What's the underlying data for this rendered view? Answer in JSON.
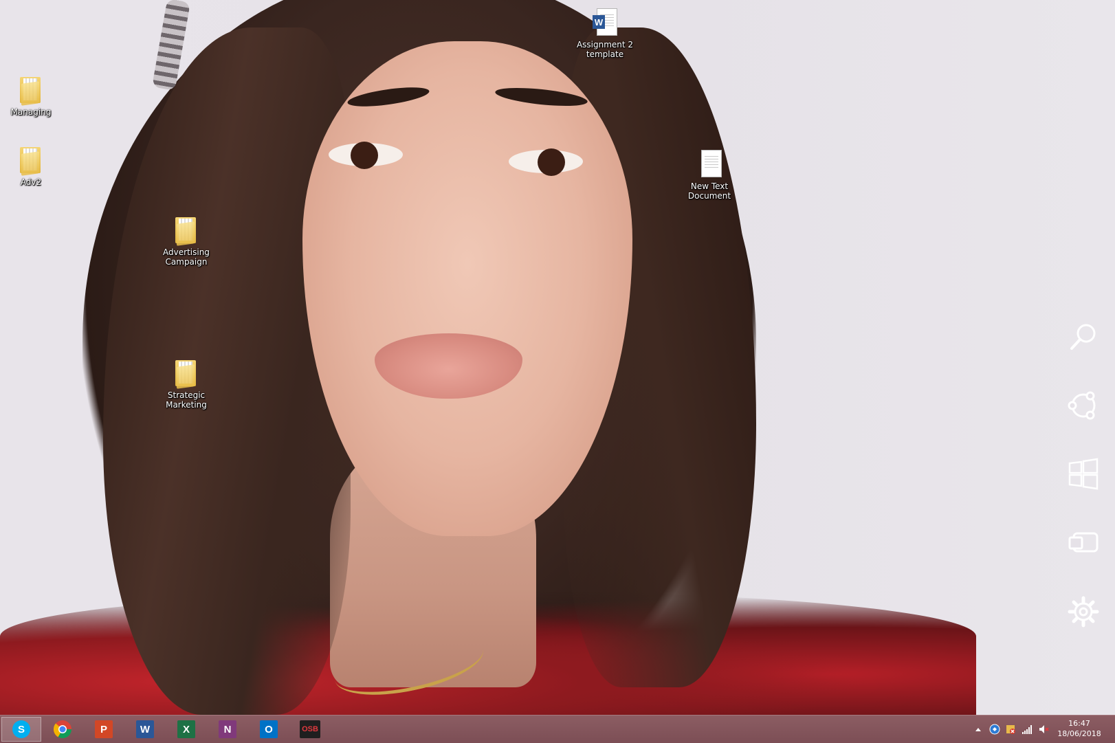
{
  "desktop": {
    "icons": [
      {
        "name": "Managing",
        "type": "folder"
      },
      {
        "name": "Adv2",
        "type": "folder"
      },
      {
        "name": "Advertising\nCampaign",
        "type": "folder"
      },
      {
        "name": "Strategic\nMarketing",
        "type": "folder"
      },
      {
        "name": "Assignment 2\ntemplate",
        "type": "word-document"
      },
      {
        "name": "New Text\nDocument",
        "type": "text-document"
      }
    ]
  },
  "charms": [
    "search-icon",
    "share-icon",
    "start-windows-icon",
    "devices-icon",
    "settings-icon"
  ],
  "taskbar": {
    "apps": [
      {
        "name": "Skype",
        "glyph": "S",
        "color": "#00aff0",
        "active": true
      },
      {
        "name": "Google Chrome",
        "glyph": "",
        "color": "#4285f4"
      },
      {
        "name": "PowerPoint",
        "glyph": "P",
        "color": "#d24726"
      },
      {
        "name": "Word",
        "glyph": "W",
        "color": "#2b5797"
      },
      {
        "name": "Excel",
        "glyph": "X",
        "color": "#1e7145"
      },
      {
        "name": "OneNote",
        "glyph": "N",
        "color": "#80397b"
      },
      {
        "name": "Outlook",
        "glyph": "O",
        "color": "#0072c6"
      },
      {
        "name": "OSB",
        "glyph": "OSB",
        "color": "#1f1f1f"
      }
    ],
    "tray": [
      "show-hidden-icons",
      "app-tray-icon",
      "security-icon",
      "network-signal-icon",
      "volume-muted-icon"
    ],
    "clock": {
      "time": "16:47",
      "date": "18/06/2018"
    }
  },
  "colors": {
    "taskbar": "#7c4e55",
    "desktop_bg": "#e8e4ea"
  }
}
